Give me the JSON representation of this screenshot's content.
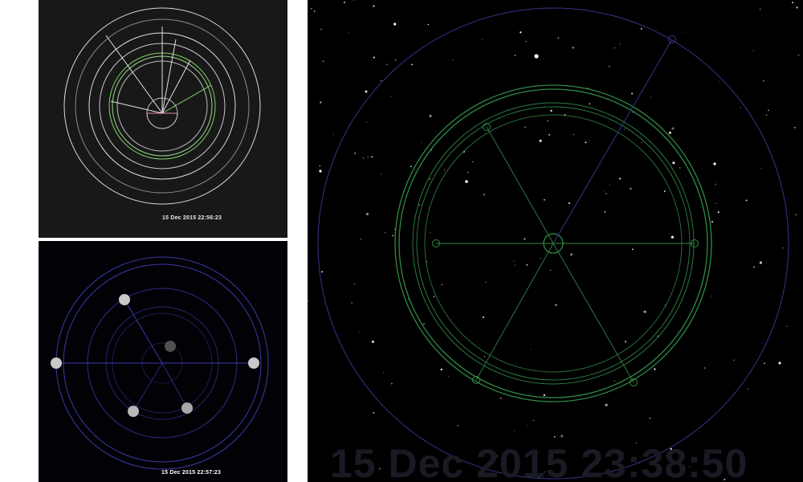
{
  "panels": {
    "top": {
      "timestamp": "15 Dec 2015 22:56:23",
      "colors": {
        "background": "#181818",
        "ring": "#e8e8e8",
        "accent_ring": "#7fd36a",
        "center": "#e08aa0"
      }
    },
    "bottom": {
      "timestamp": "15 Dec 2015 22:57:23",
      "colors": {
        "background": "#020206",
        "ring": "#3a3aa8",
        "planet": "#c8c8c8"
      }
    },
    "right": {
      "timestamp": "15 Dec 2015 23:38:50",
      "colors": {
        "background": "#000000",
        "outer_ring": "#35358a",
        "orbit_ring": "#2f8a45",
        "spoke": "#2f8a45",
        "star": "#ffffff"
      }
    }
  }
}
